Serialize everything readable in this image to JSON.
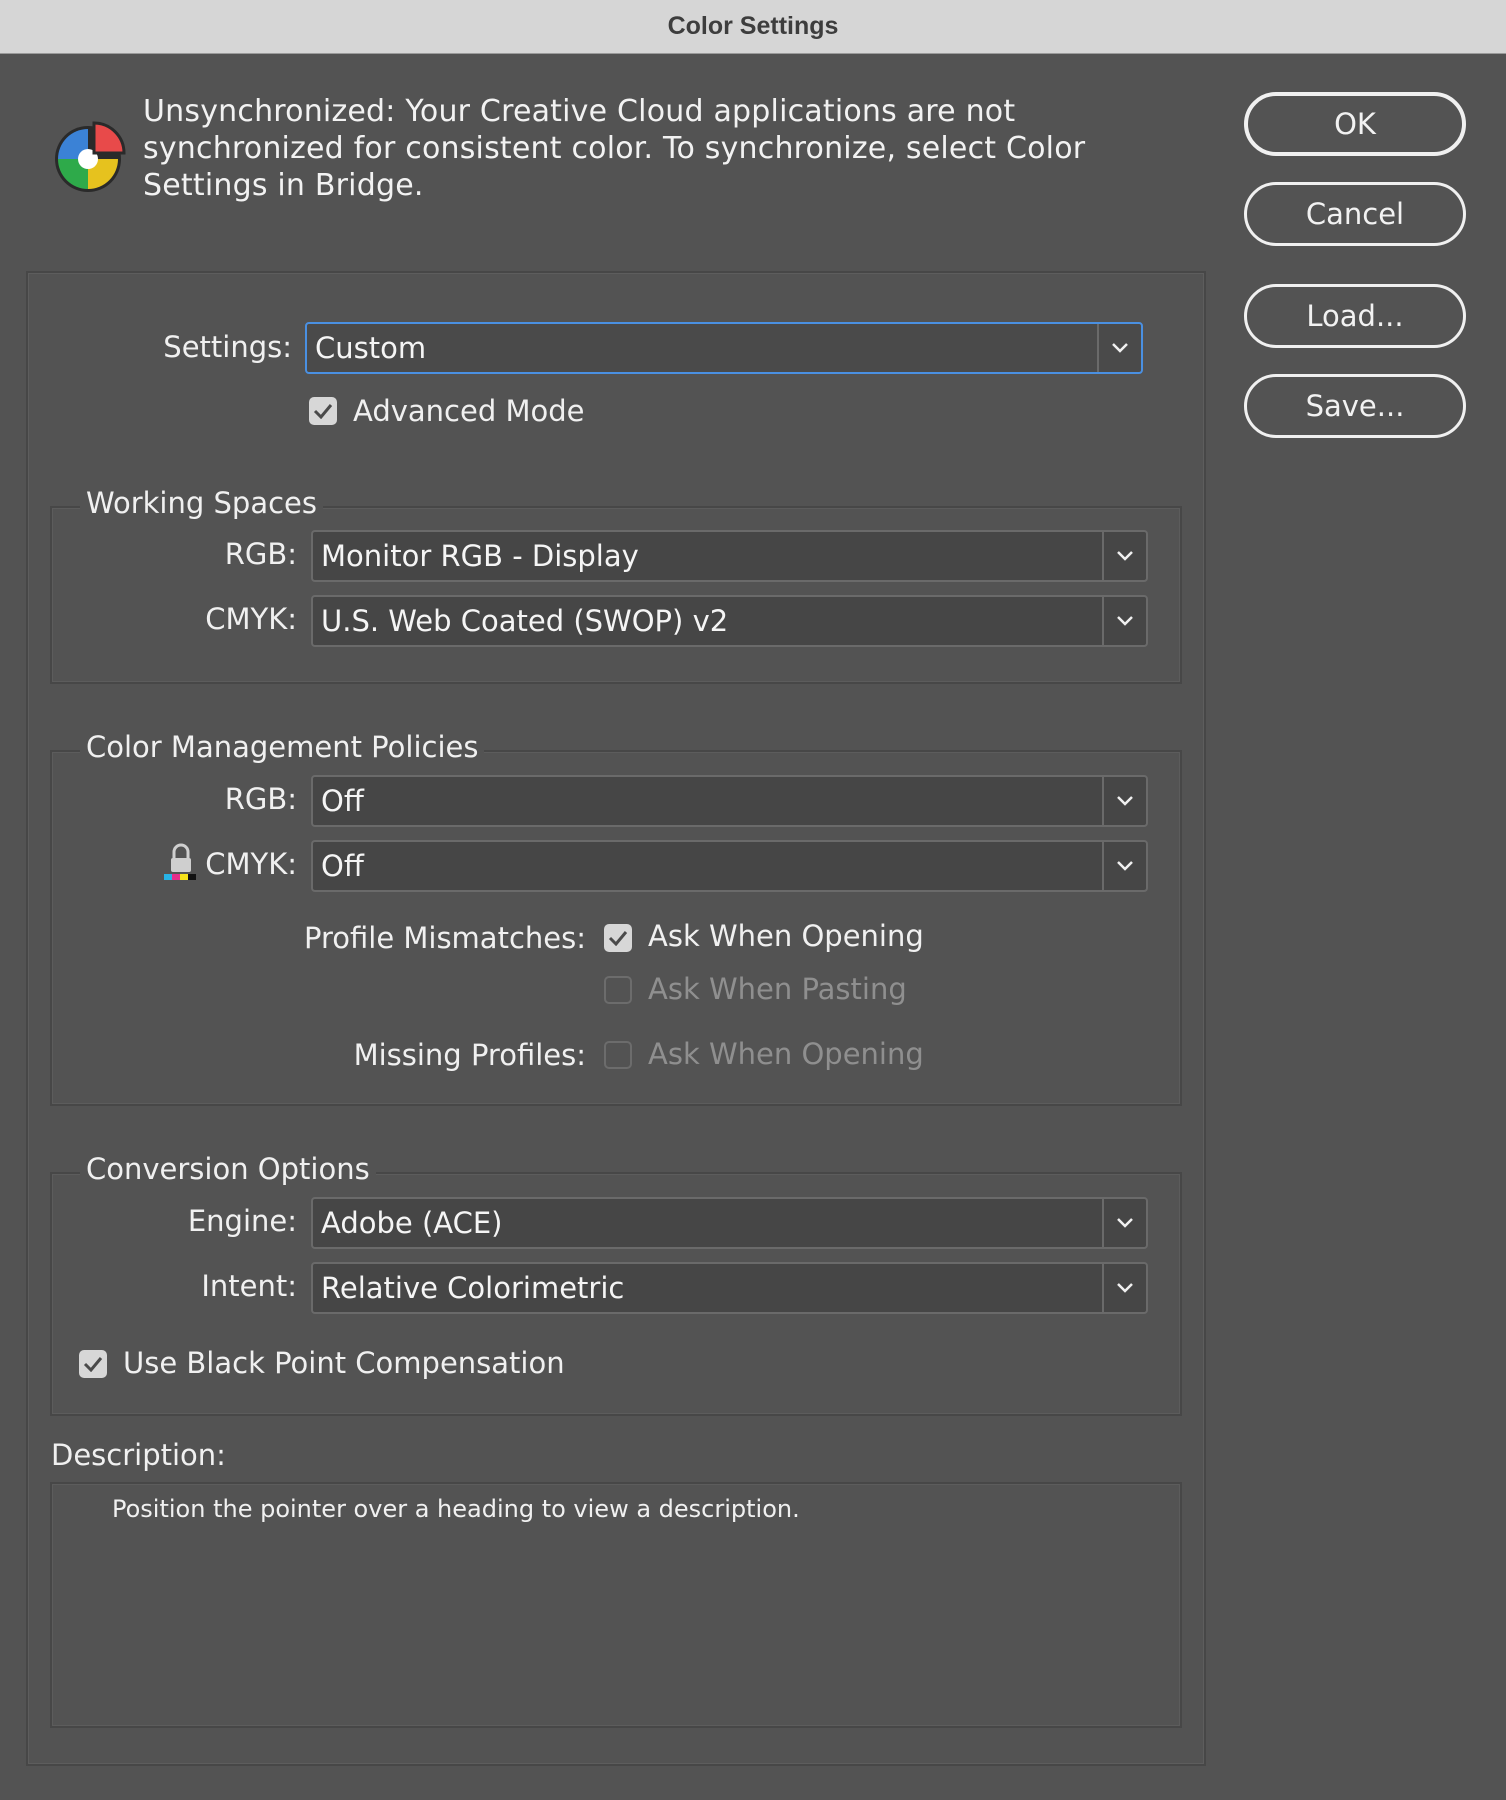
{
  "window": {
    "title": "Color Settings"
  },
  "sync": {
    "message": "Unsynchronized: Your Creative Cloud applications are not synchronized for consistent color. To synchronize, select Color Settings in Bridge.",
    "icon": "color-wheel-icon"
  },
  "buttons": {
    "ok": "OK",
    "cancel": "Cancel",
    "load": "Load...",
    "save": "Save..."
  },
  "settings": {
    "label": "Settings:",
    "value": "Custom",
    "advanced_mode": {
      "label": "Advanced Mode",
      "checked": true
    }
  },
  "working_spaces": {
    "title": "Working Spaces",
    "rgb": {
      "label": "RGB:",
      "value": "Monitor RGB - Display"
    },
    "cmyk": {
      "label": "CMYK:",
      "value": "U.S. Web Coated (SWOP) v2"
    }
  },
  "policies": {
    "title": "Color Management Policies",
    "rgb": {
      "label": "RGB:",
      "value": "Off"
    },
    "cmyk": {
      "label": "CMYK:",
      "value": "Off"
    },
    "profile_mismatches": {
      "label": "Profile Mismatches:",
      "ask_opening": {
        "label": "Ask When Opening",
        "checked": true
      },
      "ask_pasting": {
        "label": "Ask When Pasting",
        "checked": false
      }
    },
    "missing_profiles": {
      "label": "Missing Profiles:",
      "ask_opening": {
        "label": "Ask When Opening",
        "checked": false
      }
    }
  },
  "conversion": {
    "title": "Conversion Options",
    "engine": {
      "label": "Engine:",
      "value": "Adobe (ACE)"
    },
    "intent": {
      "label": "Intent:",
      "value": "Relative Colorimetric"
    },
    "black_point": {
      "label": "Use Black Point Compensation",
      "checked": true
    }
  },
  "description": {
    "label": "Description:",
    "text": "Position the pointer over a heading to view a description."
  },
  "colors": {
    "background": "#535353",
    "titlebar": "#d6d6d6",
    "focus": "#4a90e2"
  }
}
